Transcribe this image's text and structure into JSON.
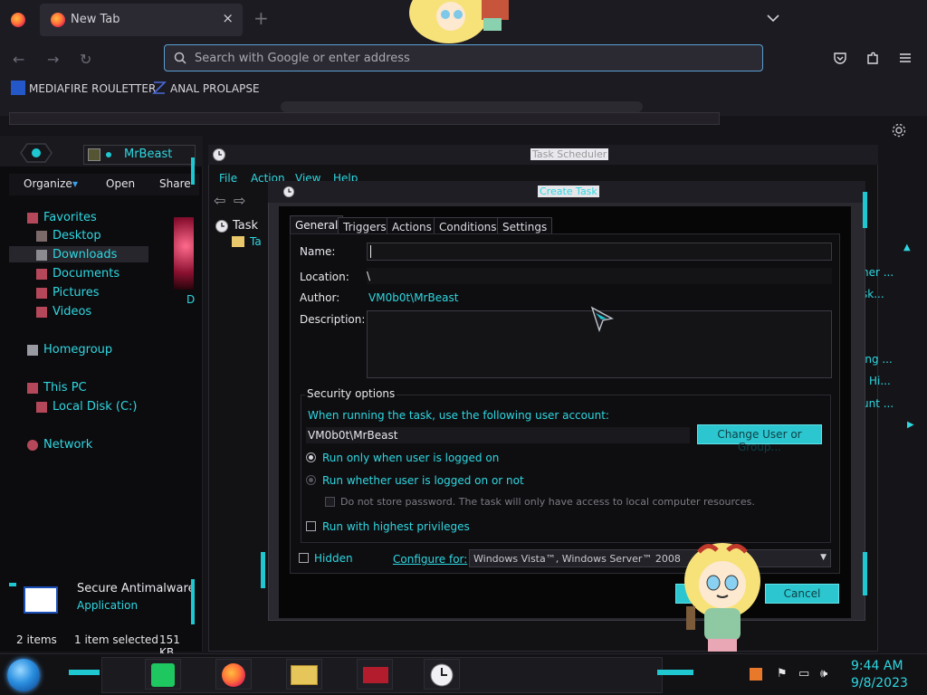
{
  "browser": {
    "tab_title": "New Tab",
    "tab_close": "×",
    "new_tab": "+",
    "search_placeholder": "Search with Google or enter address",
    "bookmarks": [
      {
        "label": "MEDIAFIRE ROULETTER"
      },
      {
        "label": "ANAL PROLAPSE"
      }
    ]
  },
  "explorer": {
    "address": "MrBeast",
    "toolbar": {
      "organize": "Organize",
      "open": "Open",
      "share": "Share"
    },
    "nav": {
      "favorites": "Favorites",
      "desktop": "Desktop",
      "downloads": "Downloads",
      "documents": "Documents",
      "pictures": "Pictures",
      "videos": "Videos",
      "homegroup": "Homegroup",
      "this_pc": "This PC",
      "local_disk": "Local Disk (C:)",
      "network": "Network"
    },
    "details": {
      "name": "Secure Antimalware",
      "type": "Application"
    },
    "status": {
      "items": "2 items",
      "selected": "1 item selected",
      "size": "151 KB"
    }
  },
  "task_scheduler": {
    "title": "Task Scheduler",
    "menu": {
      "file": "File",
      "action": "Action",
      "view": "View",
      "help": "Help"
    },
    "tree_root": "Task",
    "tree_child": "Ta",
    "right_items": [
      "ner ...",
      "sk...",
      "ing ...",
      "Hi...",
      "unt ..."
    ]
  },
  "dialog": {
    "title": "Create Task",
    "tabs": [
      "General",
      "Triggers",
      "Actions",
      "Conditions",
      "Settings"
    ],
    "name_label": "Name:",
    "name_value": "",
    "location_label": "Location:",
    "location_value": "\\",
    "author_label": "Author:",
    "author_value": "VM0b0t\\MrBeast",
    "description_label": "Description:",
    "security_title": "Security options",
    "security_prompt": "When running the task, use the following user account:",
    "account": "VM0b0t\\MrBeast",
    "change_button": "Change User or Group...",
    "opt_logged_on": "Run only when user is logged on",
    "opt_whether": "Run whether user is logged on or not",
    "opt_no_store": "Do not store password.  The task will only have access to local computer resources.",
    "opt_highest": "Run with highest privileges",
    "hidden_label": "Hidden",
    "configure_label": "Configure for:",
    "configure_value": "Windows Vista™, Windows Server™ 2008",
    "ok_label": "",
    "cancel_label": "Cancel",
    "selected_option": "logged_on"
  },
  "taskbar": {
    "time": "9:44 AM",
    "date": "9/8/2023"
  },
  "colors": {
    "accent": "#2fd7e0",
    "button": "#2bc6cf",
    "background": "#0e0e11"
  }
}
